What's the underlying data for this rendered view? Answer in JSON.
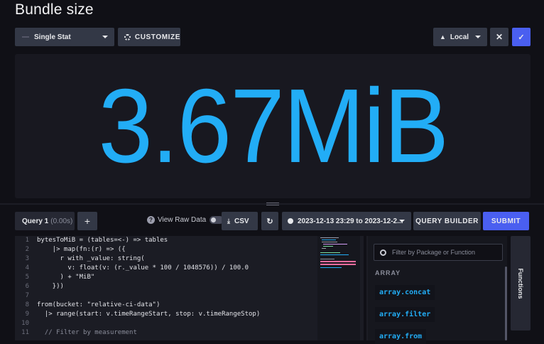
{
  "page": {
    "title": "Bundle size"
  },
  "toolbar": {
    "viz_type": "Single Stat",
    "customize_label": "CUSTOMIZE",
    "env_label": "Local",
    "cancel_icon": "close-icon",
    "confirm_icon": "check-icon"
  },
  "stat": {
    "value": "3.67MiB",
    "color": "#22adf6"
  },
  "query": {
    "tab_label": "Query 1",
    "tab_duration": "(0.00s)",
    "add_label": "+",
    "raw_data_label": "View Raw Data",
    "raw_data_info": "?",
    "csv_label": "CSV",
    "time_range": "2023-12-13 23:29 to 2023-12-2...",
    "query_builder_label": "QUERY BUILDER",
    "submit_label": "SUBMIT"
  },
  "editor": {
    "lines": [
      {
        "n": "1",
        "t": "bytesToMiB = (tables=<-) => tables"
      },
      {
        "n": "2",
        "t": "    |> map(fn:(r) => ({"
      },
      {
        "n": "3",
        "t": "      r with _value: string("
      },
      {
        "n": "4",
        "t": "        v: float(v: (r._value * 100 / 1048576)) / 100.0"
      },
      {
        "n": "5",
        "t": "      ) + \"MiB\""
      },
      {
        "n": "6",
        "t": "    }))"
      },
      {
        "n": "7",
        "t": ""
      },
      {
        "n": "8",
        "t": "from(bucket: \"relative-ci-data\")"
      },
      {
        "n": "9",
        "t": "  |> range(start: v.timeRangeStart, stop: v.timeRangeStop)"
      },
      {
        "n": "10",
        "t": ""
      },
      {
        "n": "11",
        "t": "  // Filter by measurement"
      }
    ]
  },
  "functions": {
    "search_placeholder": "Filter by Package or Function",
    "category": "ARRAY",
    "items": [
      "array.concat",
      "array.filter",
      "array.from"
    ],
    "tab_label": "Functions"
  },
  "colors": {
    "accent": "#4a5ff0",
    "stat": "#22adf6",
    "background": "#101016"
  }
}
